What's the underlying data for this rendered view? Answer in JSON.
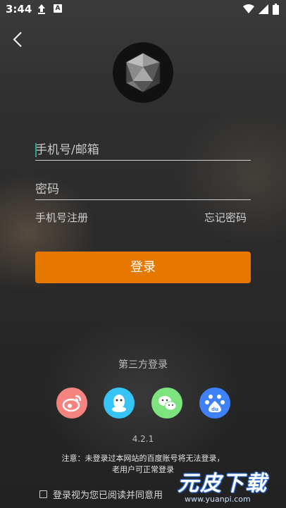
{
  "status_bar": {
    "time": "3:44",
    "notification_badge": "A"
  },
  "form": {
    "account_placeholder": "手机号/邮箱",
    "password_placeholder": "密码",
    "register_link": "手机号注册",
    "forgot_link": "忘记密码",
    "login_button": "登录"
  },
  "third_party": {
    "title": "第三方登录",
    "providers": [
      {
        "name": "weibo-icon",
        "color": "#f5837f"
      },
      {
        "name": "qq-icon",
        "color": "#35c4f5"
      },
      {
        "name": "wechat-icon",
        "color": "#7ce37e"
      },
      {
        "name": "baidu-icon",
        "color": "#3f82f7"
      }
    ]
  },
  "version": "4.2.1",
  "notice": {
    "line1": "注意：未登录过本网站的百度账号将无法登录，",
    "line2": "老用户可正常登录"
  },
  "agreement": {
    "text": "登录视为您已阅读并同意用"
  },
  "watermark": {
    "title": "元皮下载",
    "url": "www.yuanpi.com"
  },
  "colors": {
    "accent": "#e67700",
    "cursor": "#2aa198"
  }
}
